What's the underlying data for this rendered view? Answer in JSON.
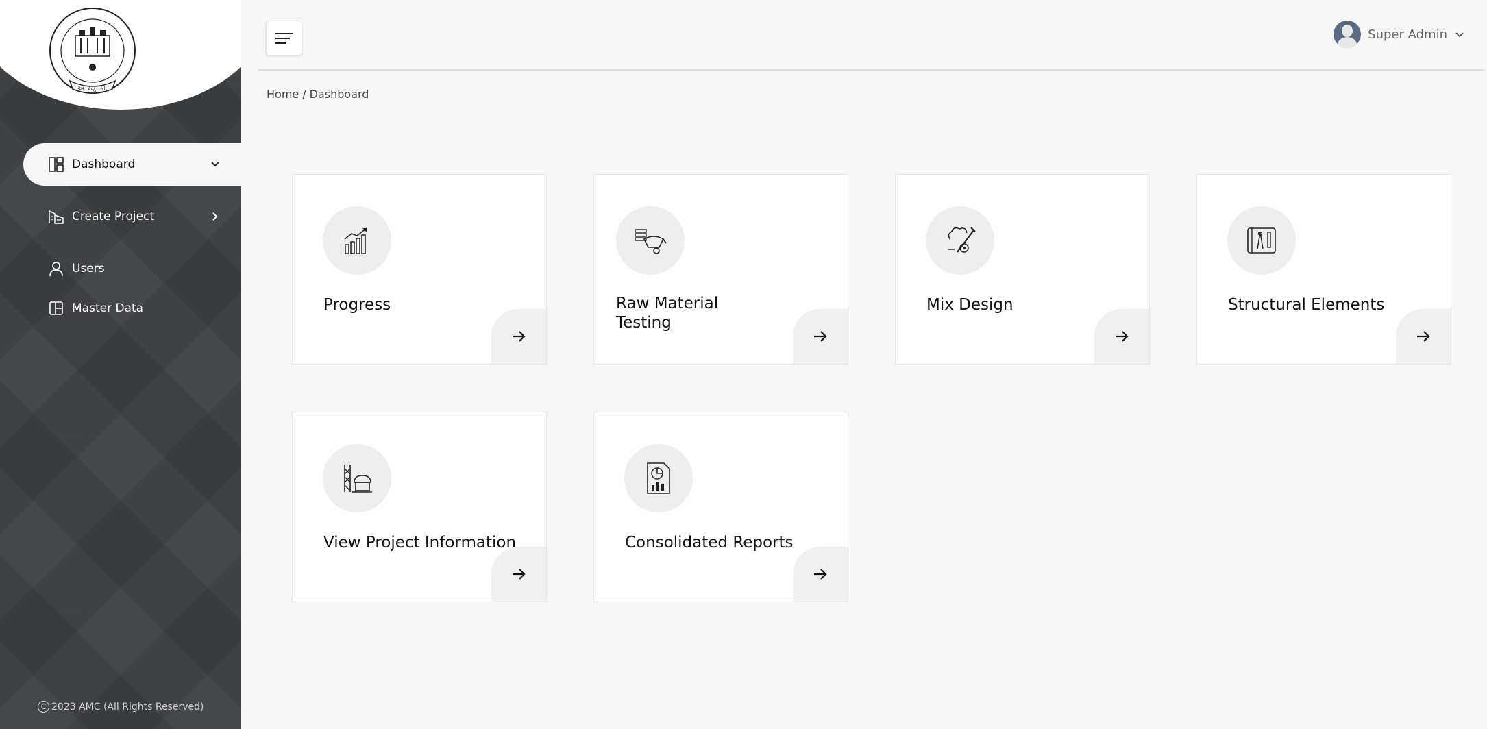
{
  "sidebar": {
    "logo_text": "AHMEDABAD MUNICIPAL CORPORATION અમદાવાદ મ્યુનિસિપલ કોર્પોરેશન",
    "items": [
      {
        "label": "Dashboard",
        "icon": "dashboard-icon"
      },
      {
        "label": "Create Project",
        "icon": "building-icon"
      },
      {
        "label": "Users",
        "icon": "user-icon"
      },
      {
        "label": "Master Data",
        "icon": "master-data-icon"
      }
    ],
    "footer": "2023 AMC (All Rights Reserved)"
  },
  "header": {
    "user_name": "Super Admin"
  },
  "breadcrumb": {
    "home": "Home",
    "separator": "/",
    "current": "Dashboard"
  },
  "cards": [
    {
      "title": "Progress",
      "icon": "progress-chart-icon"
    },
    {
      "title_line1": "Raw Material",
      "title_line2": "Testing",
      "icon": "raw-material-icon"
    },
    {
      "title": "Mix Design",
      "icon": "mix-design-icon"
    },
    {
      "title": "Structural Elements",
      "icon": "blueprint-icon"
    },
    {
      "title": "View Project Information",
      "icon": "construction-icon"
    },
    {
      "title": "Consolidated Reports",
      "icon": "report-icon"
    }
  ],
  "colors": {
    "sidebar_bg": "#3b4042",
    "page_bg": "#f7f7f7",
    "avatar": "#5a6a82"
  }
}
